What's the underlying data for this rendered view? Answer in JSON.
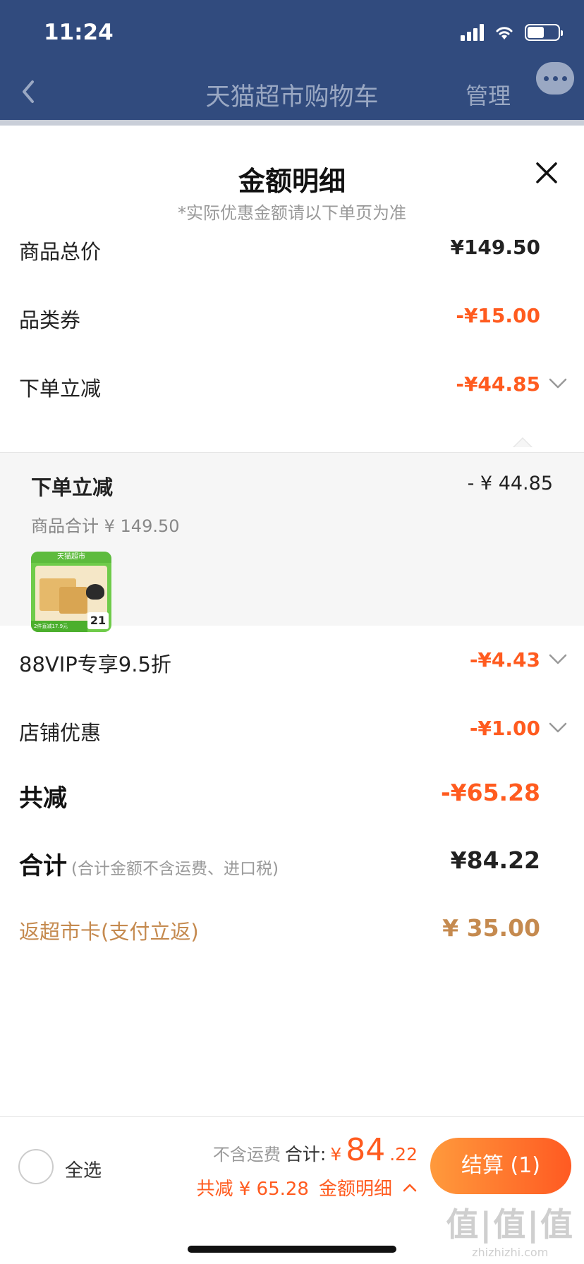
{
  "status": {
    "time": "11:24",
    "battery_level": 0.55
  },
  "nav": {
    "title": "天猫超市购物车",
    "manage": "管理",
    "back_icon": "chevron-left-icon",
    "more_icon": "more-bubble-icon"
  },
  "sheet": {
    "title": "金额明细",
    "subtitle": "*实际优惠金额请以下单页为准",
    "close_icon": "close-icon",
    "rows": {
      "goods_total": {
        "label": "商品总价",
        "value": "¥149.50"
      },
      "category_coupon": {
        "label": "品类券",
        "value": "-¥15.00"
      },
      "order_discount": {
        "label": "下单立减",
        "value": "-¥44.85"
      },
      "vip": {
        "label": "88VIP专享9.5折",
        "value": "-¥4.43"
      },
      "store": {
        "label": "店铺优惠",
        "value": "-¥1.00"
      },
      "total_reduction": {
        "label": "共减",
        "value": "-¥65.28"
      },
      "grand_total": {
        "label": "合计",
        "note": "(合计金额不含运费、进口税)",
        "value": "¥84.22"
      },
      "cashback": {
        "label": "返超市卡(支付立返)",
        "value": "¥ 35.00"
      }
    },
    "panel": {
      "title": "下单立减",
      "amount": "- ¥ 44.85",
      "subtotal": "商品合计 ¥ 149.50",
      "product": {
        "badge": "天猫超市",
        "promo": "2件直减17.9元",
        "price": "21"
      }
    }
  },
  "bottom": {
    "select_all": "全选",
    "shipping_note": "不含运费",
    "sum_label": "合计:",
    "currency": "¥",
    "sum_int": "84",
    "sum_dec": ".22",
    "reduction": "共减 ¥ 65.28",
    "detail_link": "金额明细",
    "checkout": "结算 (1)"
  },
  "watermark": {
    "big": "值|值|值",
    "small": "zhizhizhi.com"
  },
  "colors": {
    "nav_bg": "#314b7e",
    "accent_orange": "#ff5b1f",
    "gold": "#c58a4f"
  }
}
